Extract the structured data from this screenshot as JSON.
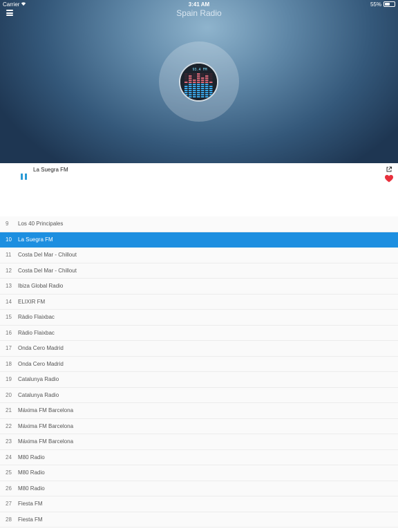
{
  "status_bar": {
    "carrier": "Carrier",
    "time": "3:41 AM",
    "battery": "55%",
    "battery_level": 0.55
  },
  "nav": {
    "title": "Spain Radio"
  },
  "icons": {
    "menu": "menu-icon",
    "pause": "pause-icon",
    "share": "share-icon",
    "favorite": "heart-icon",
    "wifi": "wifi-icon"
  },
  "colors": {
    "accent": "#1d8fe0",
    "heart": "#e8303c",
    "pause": "#2b9bd6"
  },
  "now_playing": {
    "title": "La Suegra FM",
    "artwork_text": "93.4 FM"
  },
  "stations": [
    {
      "num": "9",
      "name": "Los 40 Principales",
      "selected": false
    },
    {
      "num": "10",
      "name": "La Suegra FM",
      "selected": true
    },
    {
      "num": "11",
      "name": "Costa Del Mar - Chillout",
      "selected": false
    },
    {
      "num": "12",
      "name": "Costa Del Mar - Chillout",
      "selected": false
    },
    {
      "num": "13",
      "name": "Ibiza Global Radio",
      "selected": false
    },
    {
      "num": "14",
      "name": "ELIXIR FM",
      "selected": false
    },
    {
      "num": "15",
      "name": "Ràdio Flaixbac",
      "selected": false
    },
    {
      "num": "16",
      "name": "Ràdio Flaixbac",
      "selected": false
    },
    {
      "num": "17",
      "name": "Onda Cero Madrid",
      "selected": false
    },
    {
      "num": "18",
      "name": "Onda Cero Madrid",
      "selected": false
    },
    {
      "num": "19",
      "name": "Catalunya Radio",
      "selected": false
    },
    {
      "num": "20",
      "name": "Catalunya Radio",
      "selected": false
    },
    {
      "num": "21",
      "name": "Máxima FM Barcelona",
      "selected": false
    },
    {
      "num": "22",
      "name": "Máxima FM Barcelona",
      "selected": false
    },
    {
      "num": "23",
      "name": "Máxima FM Barcelona",
      "selected": false
    },
    {
      "num": "24",
      "name": "M80 Radio",
      "selected": false
    },
    {
      "num": "25",
      "name": "M80 Radio",
      "selected": false
    },
    {
      "num": "26",
      "name": "M80 Radio",
      "selected": false
    },
    {
      "num": "27",
      "name": "Fiesta FM",
      "selected": false
    },
    {
      "num": "28",
      "name": "Fiesta FM",
      "selected": false
    }
  ]
}
